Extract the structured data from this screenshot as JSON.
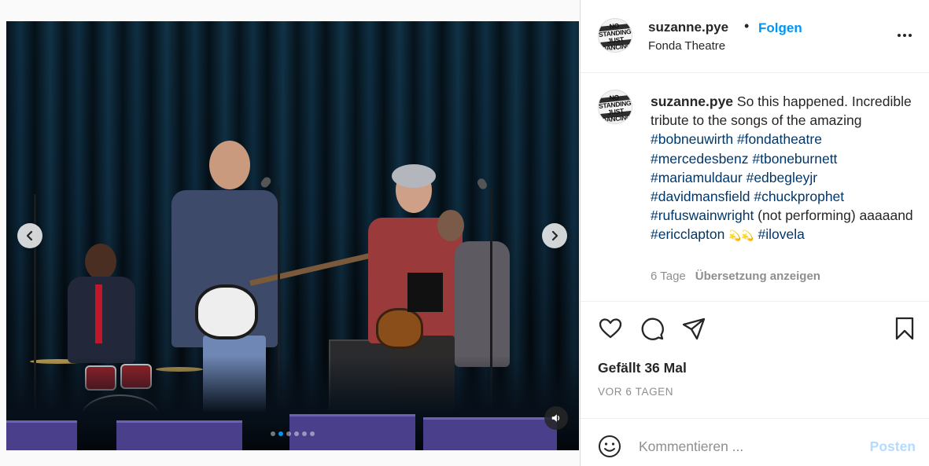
{
  "post": {
    "header": {
      "username": "suzanne.pye",
      "bullet": "•",
      "follow_label": "Folgen",
      "location": "Fonda Theatre",
      "avatar_sign_line1": "NO STANDING",
      "avatar_sign_line2": "JUST DANCING"
    },
    "caption": {
      "username": "suzanne.pye",
      "text_1": " So this happened. Incredible tribute to the songs of the amazing ",
      "tags_1": [
        "#bobneuwirth",
        "#fondatheatre",
        "#mercedesbenz",
        "#tboneburnett",
        "#mariamuldaur",
        "#edbegleyjr",
        "#davidmansfield",
        "#chuckprophet",
        "#rufuswainwright"
      ],
      "text_2": " (not performing) aaaaand ",
      "tag_eric": "#ericclapton",
      "emoji": "💫💫",
      "tag_ilovela": "#ilovela",
      "age": "6 Tage",
      "translate_label": "Übersetzung anzeigen"
    },
    "actions": {
      "like_icon": "heart-icon",
      "comment_icon": "comment-icon",
      "share_icon": "paper-plane-icon",
      "save_icon": "bookmark-icon"
    },
    "likes_text": "Gefällt 36 Mal",
    "timestamp": "VOR 6 TAGEN",
    "comment": {
      "placeholder": "Kommentieren ...",
      "post_label": "Posten"
    },
    "media": {
      "slide_count": 6,
      "active_slide": 2,
      "accent_color": "#0095f6"
    }
  }
}
